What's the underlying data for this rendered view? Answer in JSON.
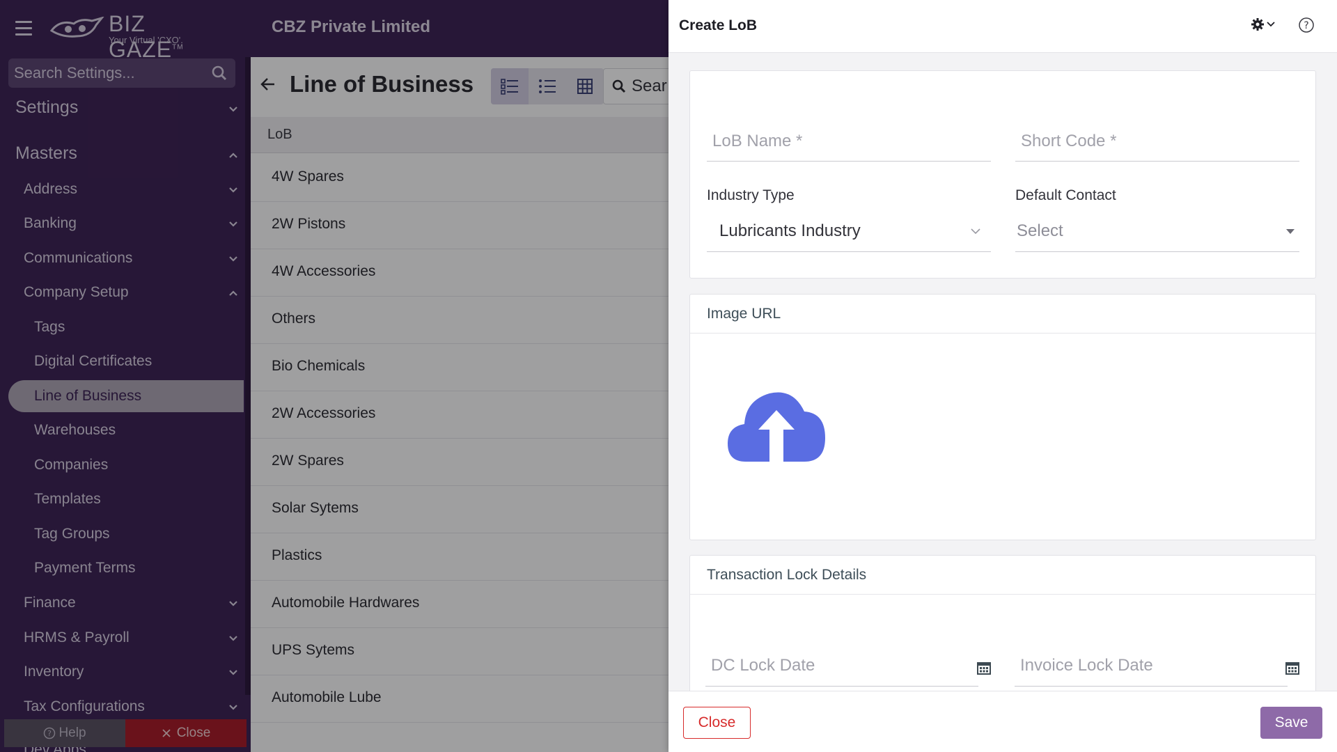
{
  "topbar": {
    "logo_text": "BIZ GAZE",
    "logo_tm": "TM",
    "logo_tagline": "Your Virtual 'CXO'.",
    "company": "CBZ Private Limited"
  },
  "sidebar": {
    "search_placeholder": "Search Settings...",
    "settings": "Settings",
    "masters": "Masters",
    "groups": [
      "Address",
      "Banking",
      "Communications",
      "Company Setup"
    ],
    "company_setup_items": [
      "Tags",
      "Digital Certificates",
      "Line of Business",
      "Warehouses",
      "Companies",
      "Templates",
      "Tag Groups",
      "Payment Terms"
    ],
    "active_item": "Line of Business",
    "more_groups": [
      "Finance",
      "HRMS & Payroll",
      "Inventory",
      "Tax Configurations"
    ],
    "cut_off": "Dev Apps",
    "help_label": "Help",
    "close_label": "Close"
  },
  "main": {
    "title": "Line of Business",
    "search_partial": "Sear",
    "column": "LoB",
    "rows": [
      "4W Spares",
      "2W Pistons",
      "4W Accessories",
      "Others",
      "Bio Chemicals",
      "2W Accessories",
      "2W Spares",
      "Solar Sytems",
      "Plastics",
      "Automobile Hardwares",
      "UPS Sytems",
      "Automobile Lube"
    ]
  },
  "drawer": {
    "title": "Create LoB",
    "lob_name_placeholder": "LoB Name *",
    "short_code_placeholder": "Short Code *",
    "industry_label": "Industry Type",
    "industry_value": "Lubricants Industry",
    "default_contact_label": "Default Contact",
    "default_contact_placeholder": "Select",
    "image_url_title": "Image URL",
    "transaction_lock_title": "Transaction Lock Details",
    "dc_lock_placeholder": "DC Lock Date",
    "invoice_lock_placeholder": "Invoice Lock Date",
    "close_label": "Close",
    "save_label": "Save"
  },
  "colors": {
    "brand_purple": "#3d2455",
    "upload_icon": "#5a6de2",
    "save_button": "#8e6aa8",
    "close_red": "#d72b2b"
  }
}
